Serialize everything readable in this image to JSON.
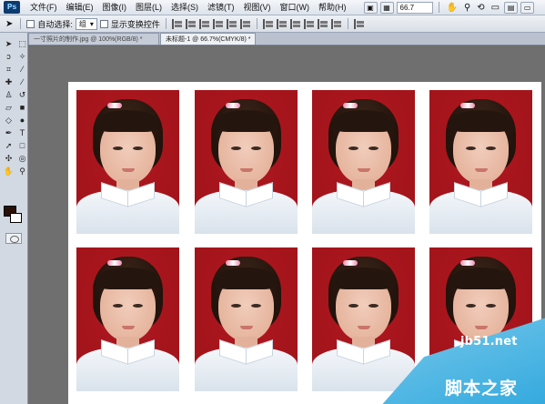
{
  "menubar": {
    "logo": "Ps",
    "items": [
      "文件(F)",
      "编辑(E)",
      "图像(I)",
      "图层(L)",
      "选择(S)",
      "滤镜(T)",
      "视图(V)",
      "窗口(W)",
      "帮助(H)"
    ],
    "zoom": "66.7"
  },
  "options": {
    "auto_select_label": "自动选择:",
    "auto_select_value": "组",
    "show_transform_label": "显示变换控件"
  },
  "tabs": [
    {
      "label": "一寸照片的制作.jpg @ 100%(RGB/8) *"
    },
    {
      "label": "未标题-1 @ 66.7%(CMYK/8) *"
    }
  ],
  "watermark": {
    "site": "jb51.net",
    "name": "脚本之家"
  },
  "colors": {
    "photo_background": "#a4141b",
    "foreground_swatch": "#2a0f07",
    "background_swatch": "#ffffff",
    "accent": "#2ea7dd"
  }
}
